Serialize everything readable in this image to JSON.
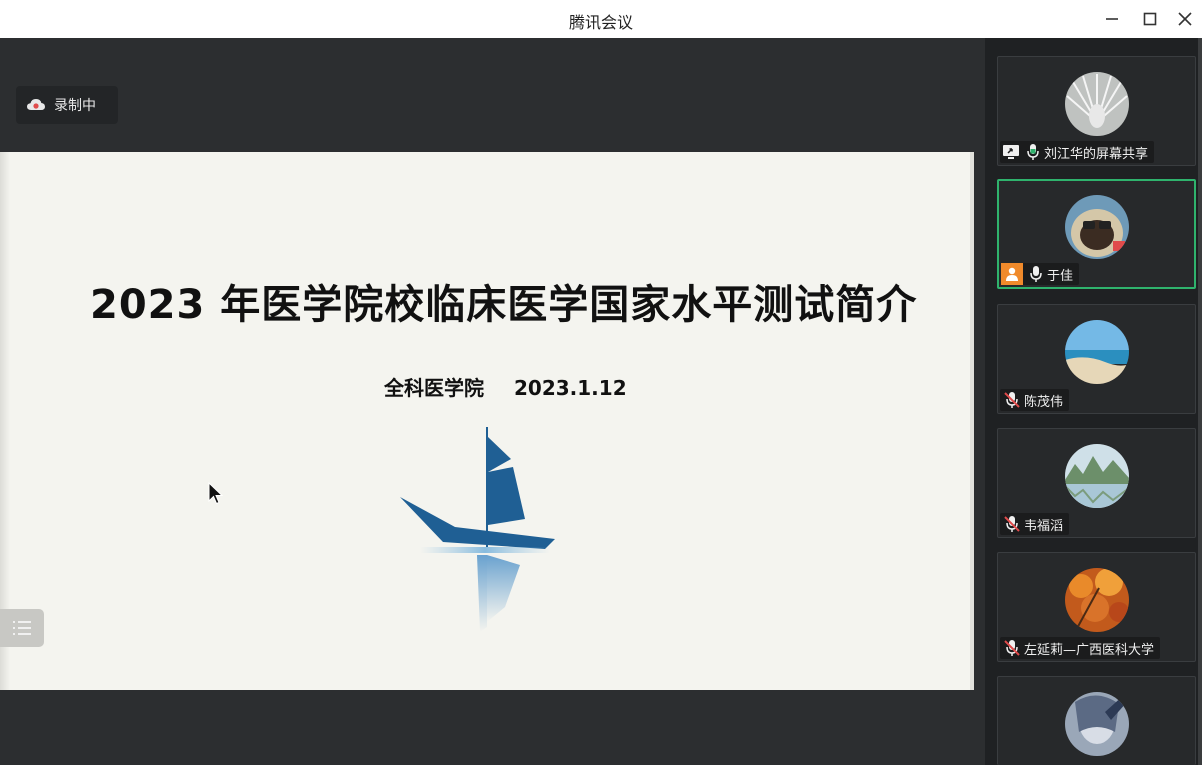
{
  "window": {
    "title": "腾讯会议"
  },
  "recording": {
    "label": "录制中"
  },
  "slide": {
    "title": "2023 年医学院校临床医学国家水平测试简介",
    "subtitle_org": "全科医学院",
    "subtitle_date": "2023.1.12"
  },
  "participants": [
    {
      "name": "刘江华的屏幕共享",
      "mic": "on",
      "screen_share": true
    },
    {
      "name": "于佳",
      "mic": "on",
      "speaking": true
    },
    {
      "name": "陈茂伟",
      "mic": "muted"
    },
    {
      "name": "韦福滔",
      "mic": "muted"
    },
    {
      "name": "左延莉—广西医科大学",
      "mic": "muted"
    },
    {
      "name": "",
      "mic": ""
    }
  ],
  "colors": {
    "accent_green": "#2fb36d",
    "sail_blue": "#1f5f94",
    "muted_red": "#e04b4b"
  }
}
